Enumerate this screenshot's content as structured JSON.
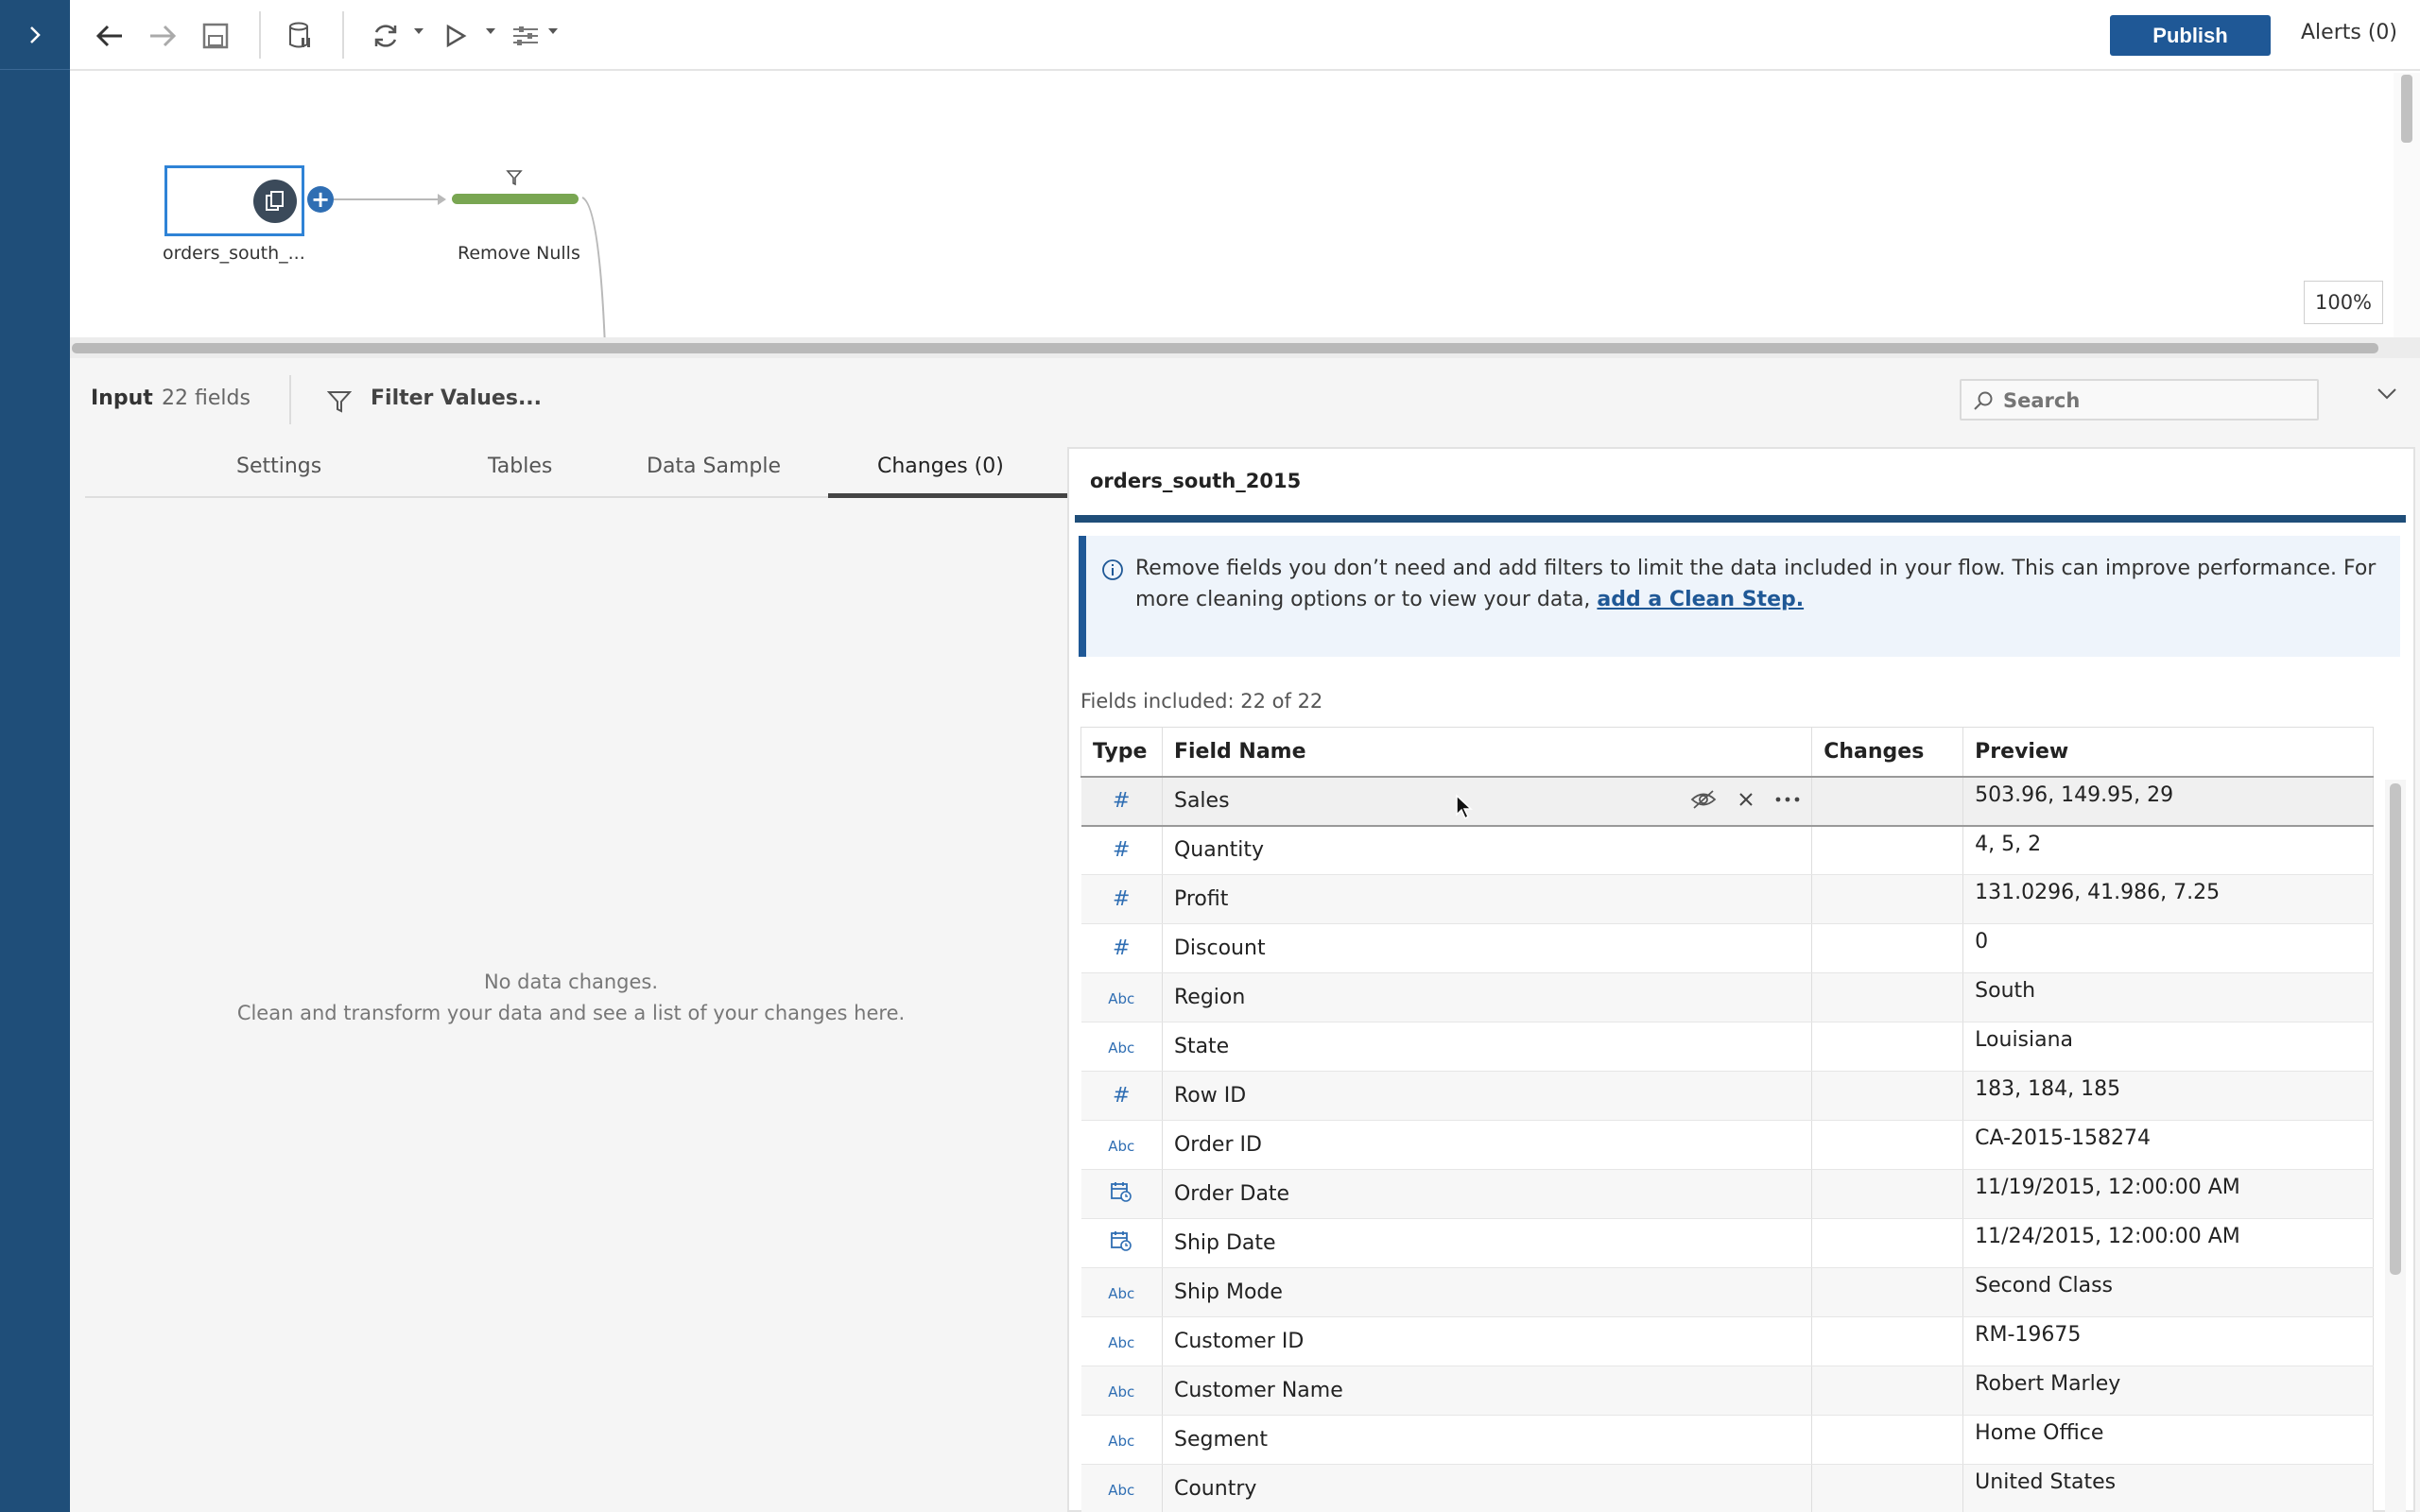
{
  "toolbar": {
    "publish_label": "Publish",
    "alerts_label": "Alerts (0)"
  },
  "canvas": {
    "input_node_label": "orders_south_...",
    "clean_node_label": "Remove Nulls",
    "zoom": "100%"
  },
  "panel": {
    "step_label": "Input",
    "fields_count": "22 fields",
    "filter_label": "Filter Values...",
    "search_placeholder": "Search",
    "tabs": [
      {
        "label": "Settings"
      },
      {
        "label": "Tables"
      },
      {
        "label": "Data Sample"
      },
      {
        "label": "Changes (0)"
      }
    ],
    "empty_line1": "No data changes.",
    "empty_line2": "Clean and transform your data and see a list of your changes here."
  },
  "card": {
    "title": "orders_south_2015",
    "info_text": "Remove fields you don’t need and add filters to limit the data included in your flow. This can improve performance. For more cleaning options or to view your data, ",
    "info_link": "add a Clean Step.",
    "fields_included": "Fields included: 22 of 22",
    "columns": {
      "type": "Type",
      "field_name": "Field Name",
      "changes": "Changes",
      "preview": "Preview"
    },
    "rows": [
      {
        "type": "#",
        "name": "Sales",
        "preview": "503.96, 149.95, 29"
      },
      {
        "type": "#",
        "name": "Quantity",
        "preview": "4, 5, 2"
      },
      {
        "type": "#",
        "name": "Profit",
        "preview": "131.0296, 41.986, 7.25"
      },
      {
        "type": "#",
        "name": "Discount",
        "preview": "0"
      },
      {
        "type": "Abc",
        "name": "Region",
        "preview": "South"
      },
      {
        "type": "Abc",
        "name": "State",
        "preview": "Louisiana"
      },
      {
        "type": "#",
        "name": "Row ID",
        "preview": "183, 184, 185"
      },
      {
        "type": "Abc",
        "name": "Order ID",
        "preview": "CA-2015-158274"
      },
      {
        "type": "date",
        "name": "Order Date",
        "preview": "11/19/2015, 12:00:00 AM"
      },
      {
        "type": "date",
        "name": "Ship Date",
        "preview": "11/24/2015, 12:00:00 AM"
      },
      {
        "type": "Abc",
        "name": "Ship Mode",
        "preview": "Second Class"
      },
      {
        "type": "Abc",
        "name": "Customer ID",
        "preview": "RM-19675"
      },
      {
        "type": "Abc",
        "name": "Customer Name",
        "preview": "Robert Marley"
      },
      {
        "type": "Abc",
        "name": "Segment",
        "preview": "Home Office"
      },
      {
        "type": "Abc",
        "name": "Country",
        "preview": "United States"
      }
    ]
  }
}
